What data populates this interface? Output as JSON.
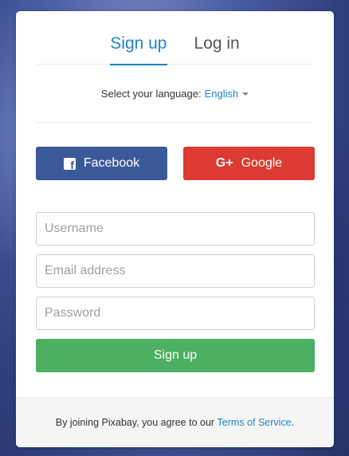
{
  "tabs": [
    {
      "label": "Sign up",
      "active": true
    },
    {
      "label": "Log in",
      "active": false
    }
  ],
  "language": {
    "label": "Select your language:",
    "selected": "English"
  },
  "social": {
    "facebook_label": "Facebook",
    "google_label": "Google",
    "google_icon": "G+"
  },
  "form": {
    "username_placeholder": "Username",
    "email_placeholder": "Email address",
    "password_placeholder": "Password",
    "submit_label": "Sign up"
  },
  "footer": {
    "text_prefix": "By joining Pixabay, you agree to our",
    "tos_link": "Terms of Service",
    "text_suffix": "."
  },
  "colors": {
    "accent": "#1d84c6",
    "facebook": "#3b5998",
    "google": "#dc3a32",
    "submit": "#4caf61"
  }
}
